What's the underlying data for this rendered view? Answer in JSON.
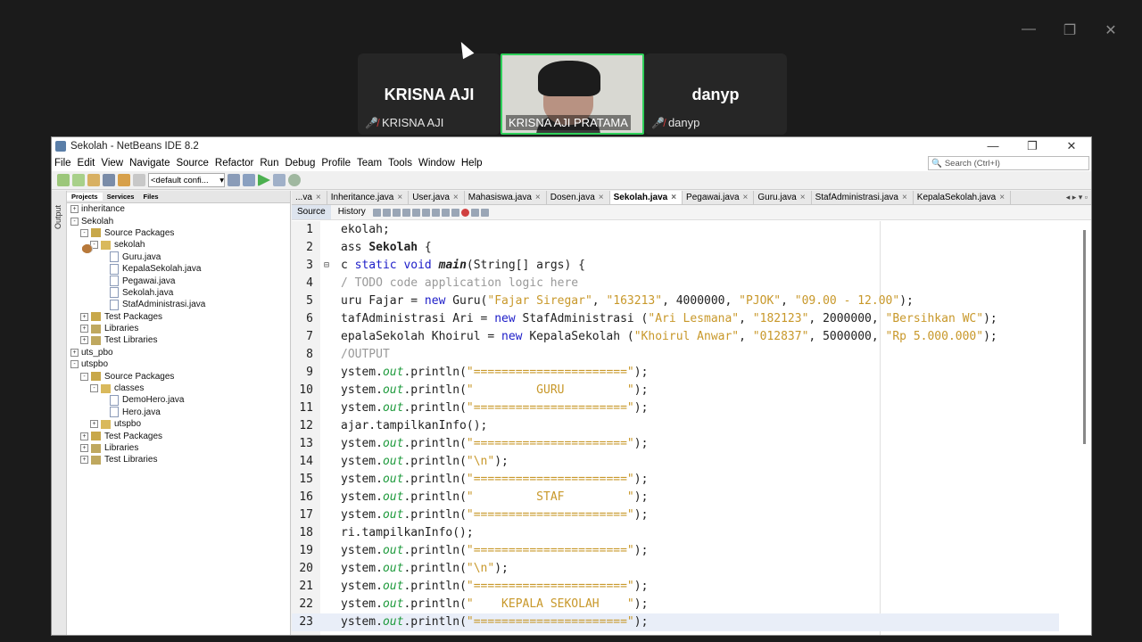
{
  "meeting": {
    "participants": [
      {
        "display": "KRISNA AJI",
        "name": "KRISNA AJI",
        "muted": true
      },
      {
        "display": "",
        "name": "KRISNA AJI PRATAMA",
        "muted": false
      },
      {
        "display": "danyp",
        "name": "danyp",
        "muted": true
      }
    ],
    "window_controls": [
      "—",
      "❐",
      "✕"
    ]
  },
  "ide": {
    "title": "Sekolah - NetBeans IDE 8.2",
    "window_controls": [
      "—",
      "❐",
      "✕"
    ],
    "menu": [
      "File",
      "Edit",
      "View",
      "Navigate",
      "Source",
      "Refactor",
      "Run",
      "Debug",
      "Profile",
      "Team",
      "Tools",
      "Window",
      "Help"
    ],
    "search_placeholder": "Search (Ctrl+I)",
    "config_select": "<default confi...",
    "side_strip_label": "Output",
    "panel_tabs": [
      "Projects",
      "Services",
      "Files"
    ],
    "tree": [
      {
        "level": 0,
        "exp": "+",
        "icon": "proj",
        "label": "inheritance"
      },
      {
        "level": 0,
        "exp": "-",
        "icon": "proj",
        "label": "Sekolah"
      },
      {
        "level": 1,
        "exp": "-",
        "icon": "pkg",
        "label": "Source Packages"
      },
      {
        "level": 2,
        "exp": "-",
        "icon": "fold",
        "label": "sekolah"
      },
      {
        "level": 3,
        "exp": "",
        "icon": "java",
        "label": "Guru.java"
      },
      {
        "level": 3,
        "exp": "",
        "icon": "java",
        "label": "KepalaSekolah.java"
      },
      {
        "level": 3,
        "exp": "",
        "icon": "java",
        "label": "Pegawai.java"
      },
      {
        "level": 3,
        "exp": "",
        "icon": "java",
        "label": "Sekolah.java"
      },
      {
        "level": 3,
        "exp": "",
        "icon": "java",
        "label": "StafAdministrasi.java"
      },
      {
        "level": 1,
        "exp": "+",
        "icon": "pkg",
        "label": "Test Packages"
      },
      {
        "level": 1,
        "exp": "+",
        "icon": "lib",
        "label": "Libraries"
      },
      {
        "level": 1,
        "exp": "+",
        "icon": "lib",
        "label": "Test Libraries"
      },
      {
        "level": 0,
        "exp": "+",
        "icon": "proj",
        "label": "uts_pbo"
      },
      {
        "level": 0,
        "exp": "-",
        "icon": "proj",
        "label": "utspbo"
      },
      {
        "level": 1,
        "exp": "-",
        "icon": "pkg",
        "label": "Source Packages"
      },
      {
        "level": 2,
        "exp": "-",
        "icon": "fold",
        "label": "classes"
      },
      {
        "level": 3,
        "exp": "",
        "icon": "java",
        "label": "DemoHero.java"
      },
      {
        "level": 3,
        "exp": "",
        "icon": "java",
        "label": "Hero.java"
      },
      {
        "level": 2,
        "exp": "+",
        "icon": "fold",
        "label": "utspbo"
      },
      {
        "level": 1,
        "exp": "+",
        "icon": "pkg",
        "label": "Test Packages"
      },
      {
        "level": 1,
        "exp": "+",
        "icon": "lib",
        "label": "Libraries"
      },
      {
        "level": 1,
        "exp": "+",
        "icon": "lib",
        "label": "Test Libraries"
      }
    ],
    "editor_tabs": [
      {
        "label": "...va",
        "active": false
      },
      {
        "label": "Inheritance.java",
        "active": false
      },
      {
        "label": "User.java",
        "active": false
      },
      {
        "label": "Mahasiswa.java",
        "active": false
      },
      {
        "label": "Dosen.java",
        "active": false
      },
      {
        "label": "Sekolah.java",
        "active": true
      },
      {
        "label": "Pegawai.java",
        "active": false
      },
      {
        "label": "Guru.java",
        "active": false
      },
      {
        "label": "StafAdministrasi.java",
        "active": false
      },
      {
        "label": "KepalaSekolah.java",
        "active": false
      }
    ],
    "view_tabs": [
      "Source",
      "History"
    ],
    "code": [
      {
        "n": "1",
        "html": "ekolah;"
      },
      {
        "n": "2",
        "html": "ass <span class='b'>Sekolah</span> {"
      },
      {
        "n": "3",
        "html": "c <span class='kw'>static</span> <span class='kw'>void</span> <span class='fn'><i>main</i></span>(String[] args) {",
        "fold": "−"
      },
      {
        "n": "4",
        "html": "<span class='cm'>/ TODO code application logic here</span>"
      },
      {
        "n": "5",
        "html": "uru Fajar = <span class='kw'>new</span> Guru(<span class='str'>\"Fajar Siregar\"</span>, <span class='str'>\"163213\"</span>, 4000000, <span class='str'>\"PJOK\"</span>, <span class='str'>\"09.00 - 12.00\"</span>);"
      },
      {
        "n": "6",
        "html": "tafAdministrasi Ari = <span class='kw'>new</span> StafAdministrasi (<span class='str'>\"Ari Lesmana\"</span>, <span class='str'>\"182123\"</span>, 2000000, <span class='str'>\"Bersihkan WC\"</span>);"
      },
      {
        "n": "7",
        "html": "epalaSekolah Khoirul = <span class='kw'>new</span> KepalaSekolah (<span class='str'>\"Khoirul Anwar\"</span>, <span class='str'>\"012837\"</span>, 5000000, <span class='str'>\"Rp 5.000.000\"</span>);"
      },
      {
        "n": "8",
        "html": "<span class='cm'>/OUTPUT</span>"
      },
      {
        "n": "9",
        "html": "ystem.<span class='it'>out</span>.println(<span class='str'>\"======================\"</span>);"
      },
      {
        "n": "10",
        "html": "ystem.<span class='it'>out</span>.println(<span class='str'>\"         GURU         \"</span>);"
      },
      {
        "n": "11",
        "html": "ystem.<span class='it'>out</span>.println(<span class='str'>\"======================\"</span>);"
      },
      {
        "n": "12",
        "html": "ajar.tampilkanInfo();"
      },
      {
        "n": "13",
        "html": "ystem.<span class='it'>out</span>.println(<span class='str'>\"======================\"</span>);"
      },
      {
        "n": "14",
        "html": "ystem.<span class='it'>out</span>.println(<span class='str'>\"\\n\"</span>);"
      },
      {
        "n": "15",
        "html": "ystem.<span class='it'>out</span>.println(<span class='str'>\"======================\"</span>);"
      },
      {
        "n": "16",
        "html": "ystem.<span class='it'>out</span>.println(<span class='str'>\"         STAF         \"</span>);"
      },
      {
        "n": "17",
        "html": "ystem.<span class='it'>out</span>.println(<span class='str'>\"======================\"</span>);"
      },
      {
        "n": "18",
        "html": "ri.tampilkanInfo();"
      },
      {
        "n": "19",
        "html": "ystem.<span class='it'>out</span>.println(<span class='str'>\"======================\"</span>);"
      },
      {
        "n": "20",
        "html": "ystem.<span class='it'>out</span>.println(<span class='str'>\"\\n\"</span>);"
      },
      {
        "n": "21",
        "html": "ystem.<span class='it'>out</span>.println(<span class='str'>\"======================\"</span>);"
      },
      {
        "n": "22",
        "html": "ystem.<span class='it'>out</span>.println(<span class='str'>\"    KEPALA SEKOLAH    \"</span>);"
      },
      {
        "n": "23",
        "html": "ystem.<span class='it'>out</span>.println(<span class='str'>\"======================\"</span>);"
      }
    ]
  }
}
